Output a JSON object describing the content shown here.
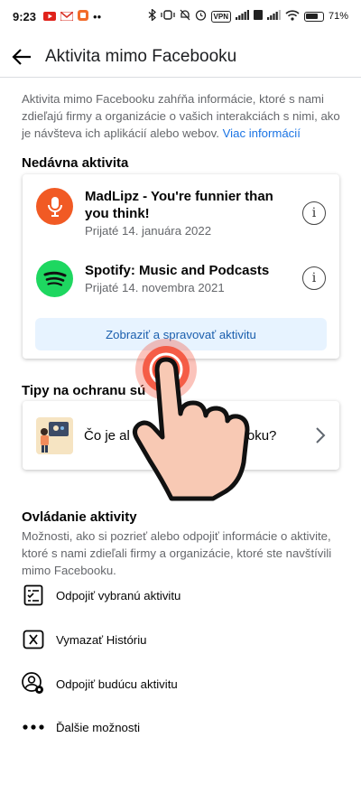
{
  "status_bar": {
    "time": "9:23",
    "notification_dots": "••",
    "vpn_label": "VPN",
    "battery_percent": "71"
  },
  "header": {
    "title": "Aktivita mimo Facebooku"
  },
  "intro": {
    "text": "Aktivita mimo Facebooku zahŕňa informácie, ktoré s nami zdieľajú firmy a organizácie o vašich interakciách s nimi, ako je návšteva ich aplikácií alebo webov.",
    "link": "Viac informácií"
  },
  "recent": {
    "heading": "Nedávna aktivita",
    "items": [
      {
        "name": "MadLipz - You're funnier than you think!",
        "date": "Prijaté 14. januára 2022",
        "icon": "microphone-icon",
        "color": "#f15a24"
      },
      {
        "name": "Spotify: Music and Podcasts",
        "date": "Prijaté 14. novembra 2021",
        "icon": "spotify-icon",
        "color": "#1ed760"
      }
    ],
    "info_glyph": "i",
    "manage_button": "Zobraziť a spravovať aktivitu"
  },
  "tips": {
    "heading": "Tipy na ochranu sú",
    "card_text": "Čo je al",
    "card_text_end": "oku?"
  },
  "control": {
    "heading": "Ovládanie aktivity",
    "description": "Možnosti, ako si pozrieť alebo odpojiť informácie o aktivite, ktoré s nami zdieľali firmy a organizácie, ktoré ste navštívili mimo Facebooku.",
    "items": [
      {
        "label": "Odpojiť vybranú aktivitu",
        "icon": "checklist-icon"
      },
      {
        "label": "Vymazať Históriu",
        "icon": "clear-box-icon"
      },
      {
        "label": "Odpojiť budúcu aktivitu",
        "icon": "person-gear-icon"
      },
      {
        "label": "Ďalšie možnosti",
        "icon": "more-dots-icon"
      }
    ]
  },
  "colors": {
    "link": "#1b74e4",
    "button_bg": "#e7f3ff",
    "tap_indicator": "#f4523b",
    "hand_fill": "#f8c9b4"
  }
}
